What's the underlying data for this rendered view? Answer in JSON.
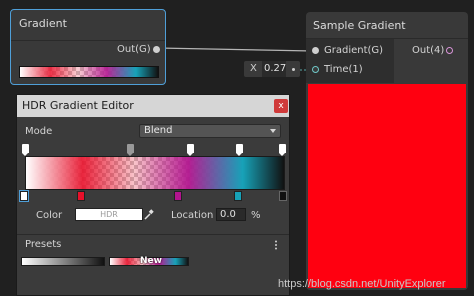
{
  "gradient_node": {
    "title": "Gradient",
    "output_label": "Out(G)"
  },
  "sample_node": {
    "title": "Sample Gradient",
    "input_gradient_label": "Gradient(G)",
    "input_time_label": "Time(1)",
    "output_label": "Out(4)",
    "preview_color": "#ff0010"
  },
  "time_field": {
    "axis_label": "X",
    "value": "0.27"
  },
  "editor": {
    "title": "HDR Gradient Editor",
    "close_label": "x",
    "mode_label": "Mode",
    "mode_value": "Blend",
    "color_label": "Color",
    "color_value": "HDR",
    "location_label": "Location",
    "location_value": "0.0",
    "location_unit": "%",
    "presets_label": "Presets",
    "preset_new_label": "New",
    "color_keys": [
      "#ffffff",
      "#e8102a",
      "#b2148e",
      "#17a2b8",
      "#111111"
    ]
  },
  "watermark": "https://blog.csdn.net/UnityExplorer",
  "colors": {
    "accent": "#4f9fd8",
    "background": "#202020",
    "node": "#393939"
  }
}
